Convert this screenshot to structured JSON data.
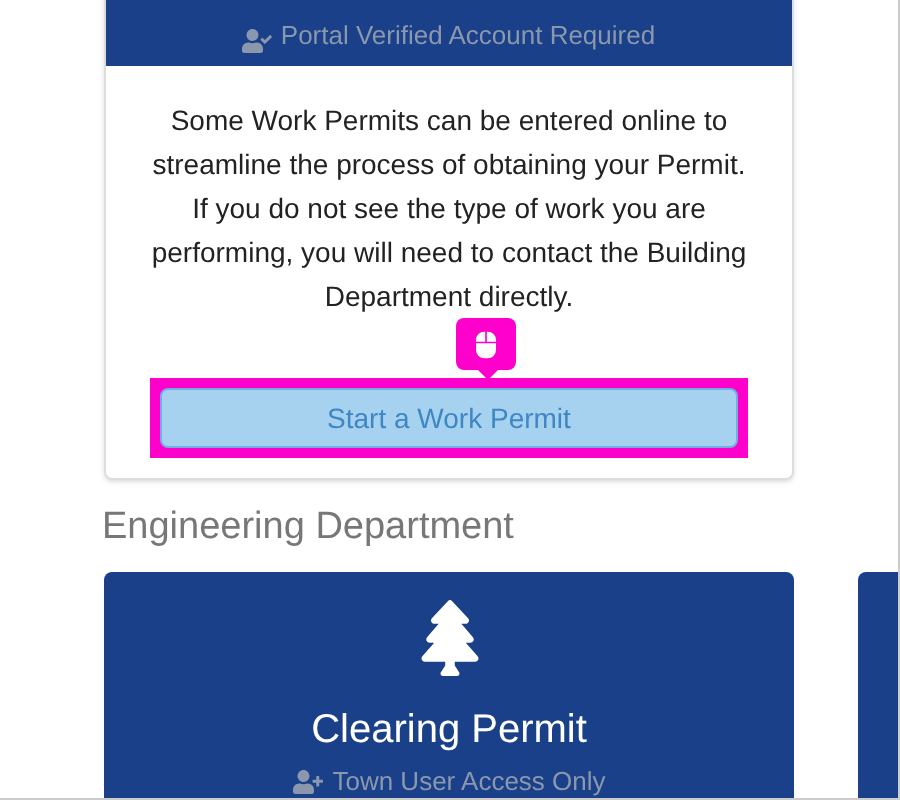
{
  "top_card": {
    "requirement": "Portal Verified Account Required",
    "description": "Some Work Permits can be entered online to streamline the process of obtaining your Permit. If you do not see the type of work you are performing, you will need to contact the Building Department directly.",
    "button": {
      "label": "Start a Work Permit",
      "disabled": true,
      "highlighted": true
    }
  },
  "section_title": "Engineering Department",
  "cards": [
    {
      "title": "Clearing Permit",
      "requirement": "Town User Access Only"
    }
  ]
}
